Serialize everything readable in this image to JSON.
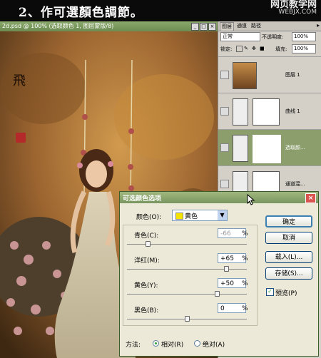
{
  "banner": {
    "title": "2、作可選顏色調節。",
    "watermark_line1": "网页教学网",
    "watermark_line2": "WEBJX.COM"
  },
  "document": {
    "title": "2d.psd @ 100% (选取颜色 1, 图层蒙版/8)",
    "photo_text": "飛"
  },
  "layers_panel": {
    "tabs": [
      "图层",
      "通道",
      "路径"
    ],
    "blend_mode": "正常",
    "opacity_label": "不透明度:",
    "opacity": "100%",
    "lock_label": "锁定:",
    "fill_label": "填充:",
    "fill": "100%",
    "layers": [
      {
        "name": "图层 1"
      },
      {
        "name": "曲线 1"
      },
      {
        "name": "选取颜..."
      },
      {
        "name": "通道混..."
      }
    ]
  },
  "dialog": {
    "title": "可选颜色选项",
    "colors_label": "颜色(O):",
    "colors_value": "黄色",
    "sliders": [
      {
        "label": "青色(C):",
        "value": "-66",
        "fraction": 0.17
      },
      {
        "label": "洋红(M):",
        "value": "+65",
        "fraction": 0.83
      },
      {
        "label": "黄色(Y):",
        "value": "+50",
        "fraction": 0.75
      },
      {
        "label": "黑色(B):",
        "value": "0",
        "fraction": 0.5
      }
    ],
    "pct": "%",
    "buttons": {
      "ok": "确定",
      "cancel": "取消",
      "load": "载入(L)...",
      "save": "存储(S)..."
    },
    "preview_label": "预览(P)",
    "preview_checked": true,
    "method_label": "方法:",
    "method_relative": "相对(R)",
    "method_absolute": "绝对(A)",
    "method_selected": "relative"
  },
  "colors": {
    "accent_green": "#7a9660",
    "swatch_yellow": "#f5e400"
  }
}
